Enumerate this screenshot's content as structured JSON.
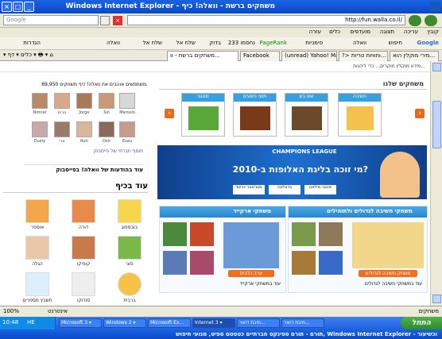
{
  "window": {
    "title": "Windows Internet Explorer - משחקים ברשת - וואלה! כיף",
    "minimize": "_",
    "maximize": "□",
    "close": "×"
  },
  "address": {
    "url": "http://fun.walla.co.il/",
    "search_placeholder": "Google"
  },
  "menu": {
    "items": [
      "קובץ",
      "עריכה",
      "תצוגה",
      "מועדפים",
      "כלים",
      "עזרה"
    ]
  },
  "toolbar": {
    "items": [
      "Google",
      "חיפוש",
      "וואלה",
      "סימניות",
      "PageRank",
      "233 נחסמו",
      "בדוק",
      "שלח אל",
      "שלח אל",
      "וואלה",
      "הגדרות"
    ]
  },
  "tabs": {
    "items": [
      "משחקים ברשת - וו...",
      "Facebook",
      "(unread) Yahoo! Mail (33) 🔁",
      "?> וחוויות טריות...",
      "מירי מוקלין הוא..."
    ]
  },
  "content": {
    "top_notice": "מידע מוקלין חוקרים... כדי ליהנות...",
    "our_games_title": "משחקים שלנו",
    "categories": [
      {
        "label": "חשיבה",
        "caption": ""
      },
      {
        "label": "שש בש",
        "caption": ""
      },
      {
        "label": "תוצי פשעים",
        "caption": ""
      },
      {
        "label": "מונגגי",
        "caption": ""
      }
    ],
    "banner": {
      "headline": "מי זוכה בליגת האלופות ב-2010?",
      "sub": "CHAMPIONS LEAGUE",
      "teams": [
        "מנצ'סטר יונייטד",
        "ברצלונה",
        "אינטר מילאנו"
      ]
    },
    "thinking_panel": {
      "title": "משחקי חשיבה לגדולים ולתוהילים",
      "button": "משחק חשיבה לגדולים",
      "more": "עוד במשחקי חשיבה לגדולים"
    },
    "arcade_panel": {
      "title": "משחקי ארקייד",
      "button": "ערב כלבים",
      "more": "עוד במשחקי ארקייד"
    },
    "friends": {
      "count_text": "69,950 משתמשים אוהבים את וואלה! כיף משחקים.",
      "names_row1": [
        "Marcelo",
        "Sol",
        "Jorge",
        "מרים",
        "Nimrat"
      ],
      "names_row2": [
        "Esau",
        "Ovir",
        "Ruti",
        "ארי",
        "Dusty"
      ],
      "plugin": "תוסף חברתי של פייסבוק",
      "more_link": "עוד בהודעות של וואלה! בפייסבוק"
    },
    "more_children": {
      "title": "עוד בכיף",
      "games": [
        "בובספוג",
        "דורה",
        "אוספר",
        "פוגי",
        "קופיקו",
        "הגלה",
        "ברבית",
        "סודוקו",
        "תשבץ מספרים"
      ]
    }
  },
  "status": {
    "left": "✓",
    "zone": "אינטרנט",
    "zoom": "100%",
    "text": "משחקים"
  },
  "taskbar": {
    "start": "התחל",
    "time": "10:48",
    "lang": "HE",
    "buttons": [
      "Microsoft 3 ▾",
      "Windows 2 ▾",
      "Microsoft Ex...",
      "Internet 3 ▾",
      "תיבת דואר...",
      "תיבת דואר..."
    ]
  },
  "bottom_taskbar_title": "תורם - תורם ספינקס חברתיים כטסטם ספיס, מנועי חיפוש, Windows Internet Explorer - וכשיעור"
}
